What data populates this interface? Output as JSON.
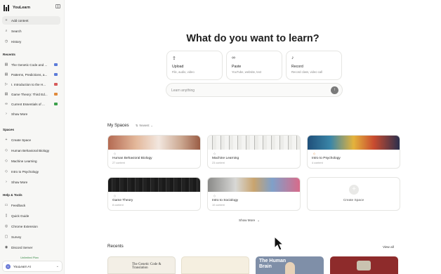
{
  "app": {
    "name": "YouLearn"
  },
  "colors": {
    "accent": "#6b7bd6",
    "upgrade": "#3c8c4a"
  },
  "sidebar": {
    "nav": [
      {
        "label": "Add content",
        "icon": "plus-icon"
      },
      {
        "label": "Search",
        "icon": "search-icon"
      },
      {
        "label": "History",
        "icon": "clock-icon"
      }
    ],
    "recents_title": "Recents",
    "recents": [
      {
        "label": "The Genetic Code and ...",
        "tag_color": "#5b7bd8"
      },
      {
        "label": "Patterns, Predictions, a...",
        "tag_color": "#5b7bd8"
      },
      {
        "label": "I. Introduction to the H...",
        "tag_color": "#d65b5b"
      },
      {
        "label": "Game Theory: Third Ed...",
        "tag_color": "#e08a3c"
      },
      {
        "label": "Current Essentials of ...",
        "tag_color": "#3ca04b"
      }
    ],
    "recents_more": "Show More",
    "spaces_title": "Spaces",
    "create_space": "Create Space",
    "spaces": [
      "Human Behavioral Biology",
      "Machine Learning",
      "Intro to Psychology"
    ],
    "spaces_more": "Show More",
    "help_title": "Help & Tools",
    "help": [
      {
        "label": "Feedback",
        "icon": "chat-icon"
      },
      {
        "label": "Quick Guide",
        "icon": "book-icon"
      },
      {
        "label": "Chrome Extension",
        "icon": "puzzle-icon"
      },
      {
        "label": "Survey",
        "icon": "clipboard-icon"
      },
      {
        "label": "Discord Server",
        "icon": "discord-icon"
      }
    ],
    "upgrade": "Unlimited Plan",
    "account": {
      "name": "YouLearn AI",
      "initial": "Y"
    }
  },
  "main": {
    "headline": "What do you want to learn?",
    "actions": [
      {
        "title": "Upload",
        "subtitle": "File, audio, video",
        "icon": "upload-icon"
      },
      {
        "title": "Paste",
        "subtitle": "YouTube, website, text",
        "icon": "link-icon"
      },
      {
        "title": "Record",
        "subtitle": "Record class, video call",
        "icon": "mic-icon"
      }
    ],
    "ask": {
      "placeholder": "Learn anything"
    },
    "spaces_title": "My Spaces",
    "sort_label": "Newest",
    "spaces": [
      {
        "title": "Human Behavioral Biology",
        "count": "27 content"
      },
      {
        "title": "Machine Learning",
        "count": "23 content"
      },
      {
        "title": "Intro to Psychology",
        "count": "4 content"
      },
      {
        "title": "Game Theory",
        "count": "8 content"
      },
      {
        "title": "Intro to Sociology",
        "count": "10 content"
      }
    ],
    "create_space": "Create Space",
    "show_more": "Show More",
    "recents_title": "Recents",
    "view_all": "View all",
    "recents": [
      {
        "text": "The Genetic Code & Translation"
      },
      {
        "text": ""
      },
      {
        "text": "The Human Brain"
      },
      {
        "text": ""
      }
    ]
  }
}
